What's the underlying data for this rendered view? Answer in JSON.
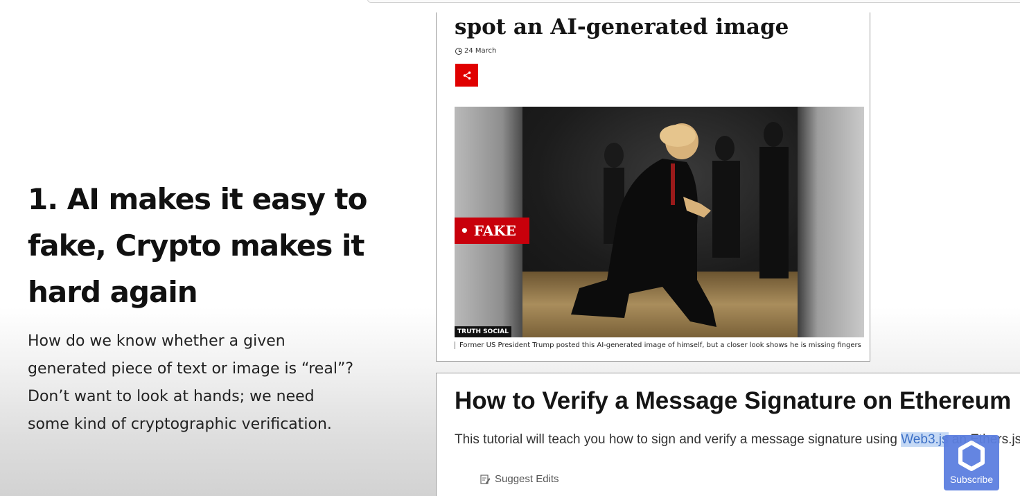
{
  "slide": {
    "title": "1. AI makes it easy to fake, Crypto makes it hard again",
    "body": "How do we know whether a given generated piece of text or image is “real”? Don’t want to look at hands; we need some kind of cryptographic verification."
  },
  "bbc_article": {
    "headline": "spot an AI-generated image",
    "date": "24 March",
    "image_tag": "• FAKE",
    "image_credit": "TRUTH SOCIAL",
    "caption": "Former US President Trump posted this AI-generated image of himself, but a closer look shows he is missing fingers",
    "accent_color": "#e00000"
  },
  "web3_article": {
    "title": "How to Verify a Message Signature on Ethereum",
    "body_before": "This tutorial will teach you how to sign and verify a message signature using ",
    "body_highlight": "Web3.js",
    "body_after": " an Ethers.js",
    "suggest_edits": "Suggest Edits"
  },
  "subscribe": {
    "label": "Subscribe",
    "color": "#5c7fe0"
  }
}
